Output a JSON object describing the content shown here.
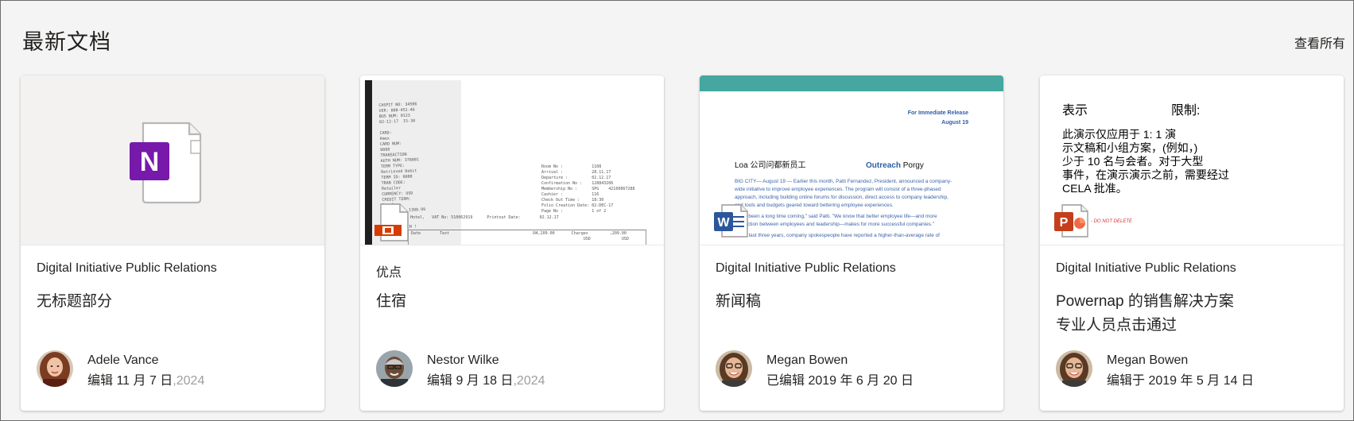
{
  "section": {
    "title": "最新文档",
    "see_all": "查看所有"
  },
  "cards": [
    {
      "site": "Digital Initiative Public Relations",
      "name_lines": [
        "无标题部分"
      ],
      "author": "Adele Vance",
      "edited_main": "编辑  11 月 7 日",
      "edited_faded": ",2024",
      "file_icon": "onenote-icon",
      "accent": "#7719aa",
      "icon_letter": "N"
    },
    {
      "site": "优点",
      "name_lines": [
        "住宿"
      ],
      "author": "Nestor Wilke",
      "edited_main": "编辑 9 月 18 日",
      "edited_faded": ",2024",
      "file_icon": "image-file-icon",
      "accent": "#d83b01",
      "receipt": {
        "left_text": "CASPIT NO: 34506\nVER: 000-452-46\nBUS NUM: 0123\n02-12-17  15-30\n\nCARD:\nAmex\nCARD NUM:\n8888\nTRANSACTION\nAUTH NUM: 378001\nTERM TYPE:\nRetrieved Debit\nTERM ID: 8000\nTRAN CODE:\nRetailer\nCURRENCY: USD\nCREDIT TERM:\nRegular\nAMNT:      1388.99\n\nTHANK YOU !\n  COME AGAIN !",
        "right_text": "Room No :            1108\nArrival :            28.11.17\nDeparture :          02.12.17\nConfirmation No :    128843206\nMembership No :      SPG    42160867288\nCashier :            116\nCheck Out Time :     18:30\nFolio Creation Date: 02-DEC-17\nPage No :            1 of 2",
        "bottom_text": "Tel Aviv Hotel,   VAT No: 510062919      Printout Date:        02.12.17",
        "table_text": "Date        Text                                   ₪4,209.00       Charges         ,209.00\n                                                                        USD             USD"
      }
    },
    {
      "site": "Digital Initiative Public Relations",
      "name_lines": [
        "新闻稿"
      ],
      "author": "Megan Bowen",
      "edited_main": "已编辑 2019 年 6 月 20 日",
      "edited_faded": "",
      "file_icon": "word-icon",
      "accent": "#2b579a",
      "icon_letter": "W",
      "press": {
        "header_1": "For Immediate Release",
        "header_2": "August 19",
        "headline_left": "Loa 公司问都新员工",
        "headline_bold": "Outreach",
        "headline_right": "Porgy",
        "body": [
          "BIG CITY— August 19 — Earlier this month, Patti Fernandez, President, announced a company-",
          "wide initiative to improve employee experiences. The program will consist of a three-phased",
          "approach, including building online forums for discussion, direct access to company leadership,",
          "and tools and budgets geared toward bettering employee experiences.",
          "",
          "It has been a long time coming,\" said Patti. \"We know that better employee life—and more",
          "interaction between employees and leadership—makes for more successful companies.\"",
          "",
          "In the last three years, company spokespeople have reported a higher-than-average rate of"
        ]
      }
    },
    {
      "site": "Digital Initiative Public Relations",
      "name_lines": [
        "Powernap 的销售解决方案",
        "专业人员点击通过"
      ],
      "author": "Megan Bowen",
      "edited_main": "编辑于 2019 年 5 月 14 日",
      "edited_faded": "",
      "file_icon": "powerpoint-icon",
      "accent": "#c43e1c",
      "icon_letter": "P",
      "slide": {
        "label_left": "表示",
        "label_right": "限制:",
        "lines": [
          "此演示仅应用于 1: 1 演",
          "示文稿和小组方案，(例如，)",
          "少于 10 名与会者。对于大型",
          "事件，在演示演示之前，需要经过",
          "CELA 批准。"
        ],
        "stamp": "- DO NOT DELETE"
      }
    }
  ]
}
